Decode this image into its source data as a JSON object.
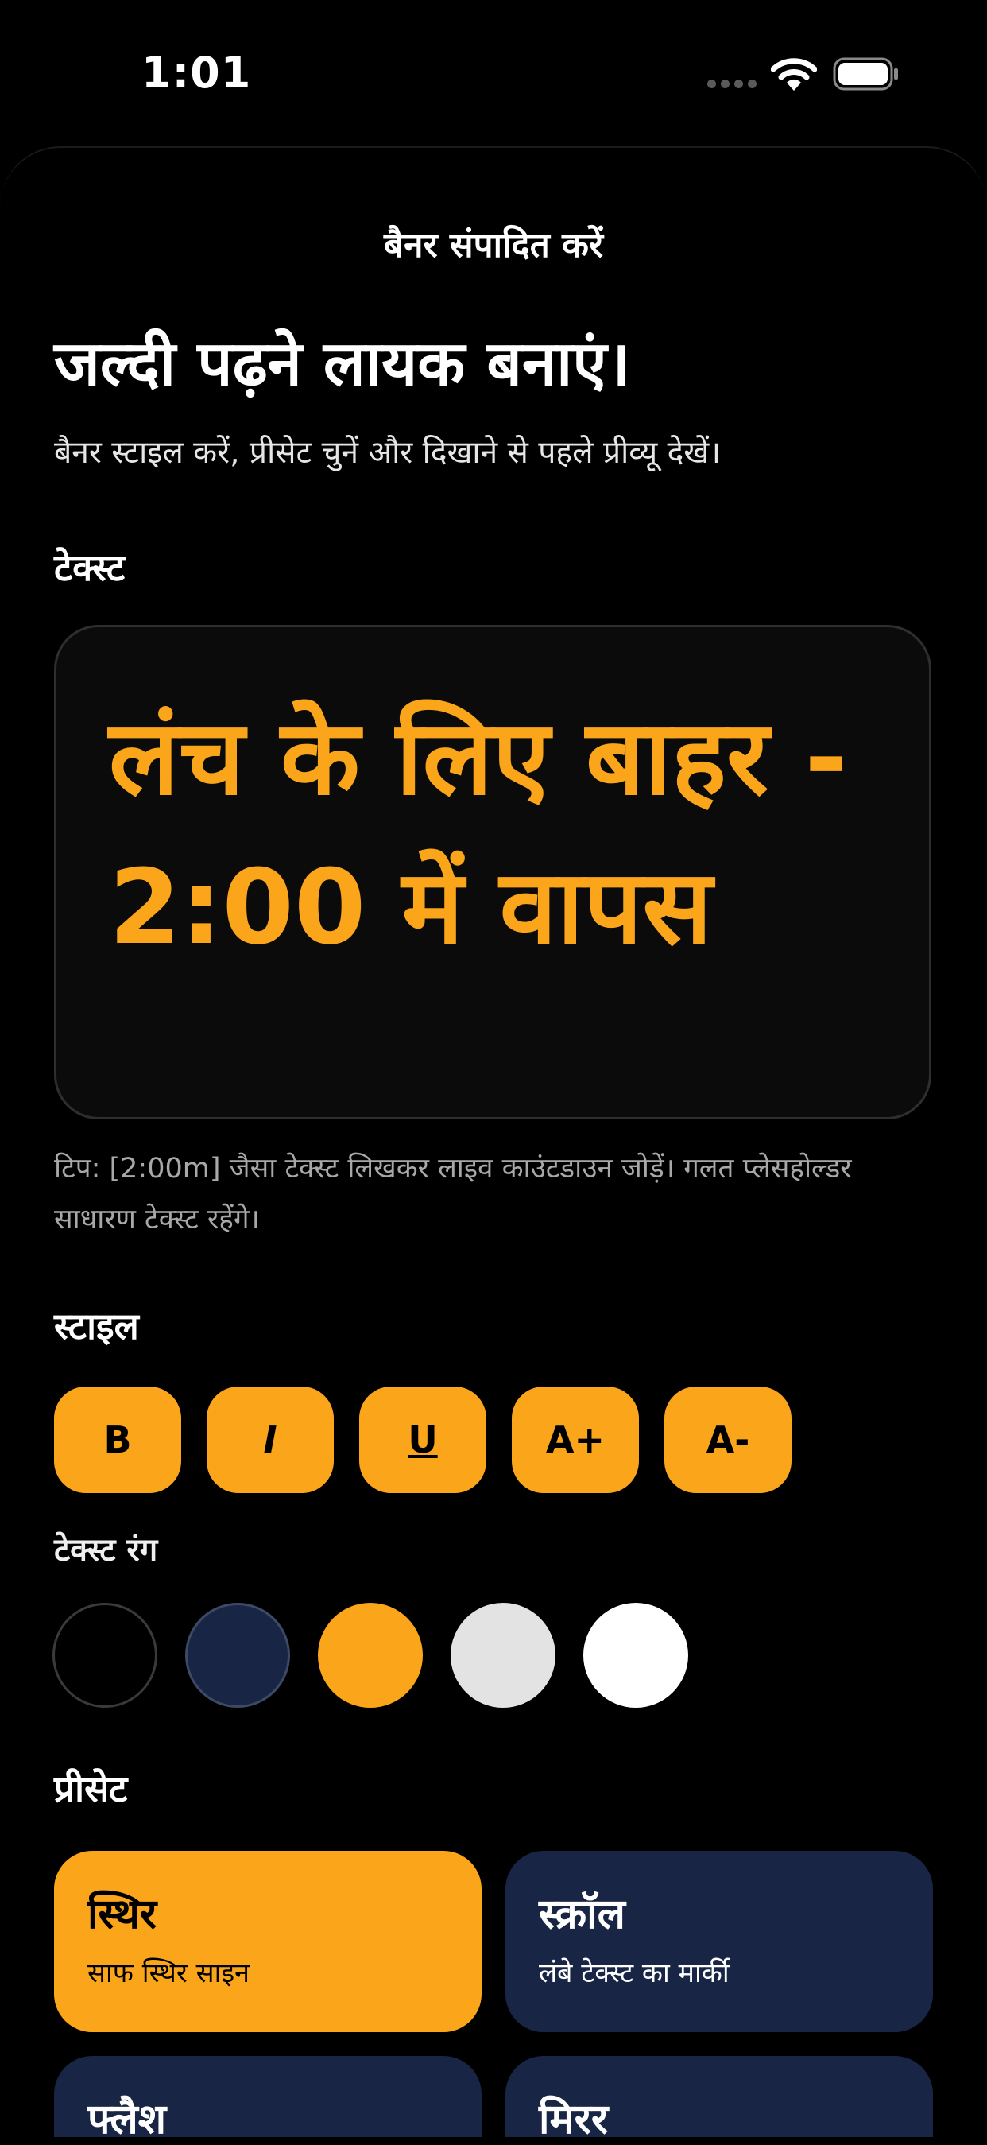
{
  "status_bar": {
    "time": "1:01"
  },
  "sheet": {
    "title": "बैनर संपादित करें"
  },
  "intro": {
    "headline": "जल्दी पढ़ने लायक बनाएं।",
    "subtitle": "बैनर स्टाइल करें, प्रीसेट चुनें और दिखाने से पहले प्रीव्यू देखें।"
  },
  "text_section": {
    "label": "टेक्स्ट",
    "value": "लंच के लिए बाहर - 2:00 में वापस",
    "tip": "टिप: [2:00m] जैसा टेक्स्ट लिखकर लाइव काउंटडाउन जोड़ें। गलत प्लेसहोल्डर साधारण टेक्स्ट रहेंगे।"
  },
  "style_section": {
    "label": "स्टाइल",
    "buttons": [
      {
        "label": "B",
        "action": "bold"
      },
      {
        "label": "I",
        "action": "italic"
      },
      {
        "label": "U",
        "action": "underline"
      },
      {
        "label": "A+",
        "action": "increase-size"
      },
      {
        "label": "A-",
        "action": "decrease-size"
      }
    ]
  },
  "color_section": {
    "label": "टेक्स्ट रंग",
    "swatches": [
      "#000000",
      "#182544",
      "#fba61a",
      "#e3e3e3",
      "#ffffff"
    ],
    "selected_color": "#fba61a"
  },
  "preset_section": {
    "label": "प्रीसेट",
    "presets": [
      {
        "title": "स्थिर",
        "subtitle": "साफ स्थिर साइन",
        "selected": true
      },
      {
        "title": "स्क्रॉल",
        "subtitle": "लंबे टेक्स्ट का मार्की",
        "selected": false
      },
      {
        "title": "फ्लैश",
        "subtitle": "",
        "selected": false
      },
      {
        "title": "मिरर",
        "subtitle": "",
        "selected": false
      }
    ]
  },
  "colors": {
    "accent": "#fba61a",
    "card_dark": "#182544",
    "background": "#000000"
  }
}
